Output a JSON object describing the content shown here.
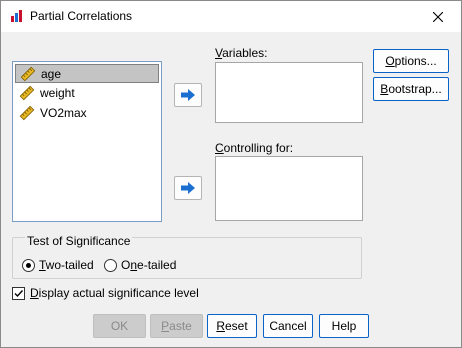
{
  "window": {
    "title": "Partial Correlations"
  },
  "variables_list": {
    "items": [
      {
        "label": "age",
        "selected": true
      },
      {
        "label": "weight",
        "selected": false
      },
      {
        "label": "VO2max",
        "selected": false
      }
    ]
  },
  "variables_field": {
    "label": "Variables:",
    "mnemonic": "V",
    "rest": "ariables:"
  },
  "controlling_field": {
    "label": "Controlling for:",
    "mnemonic": "C",
    "rest": "ontrolling for:"
  },
  "side_buttons": {
    "options": {
      "label": "Options...",
      "mnemonic": "O",
      "rest": "ptions..."
    },
    "bootstrap": {
      "label": "Bootstrap...",
      "mnemonic": "B",
      "rest": "ootstrap..."
    }
  },
  "significance": {
    "legend": "Test of Significance",
    "two_tailed": {
      "label": "Two-tailed",
      "mnemonic": "T",
      "rest": "wo-tailed",
      "checked": true
    },
    "one_tailed": {
      "label": "One-tailed",
      "mnemonic": "n",
      "prefix": "O",
      "rest": "e-tailed",
      "checked": false
    }
  },
  "display_level": {
    "label": "Display actual significance level",
    "mnemonic": "D",
    "rest": "isplay actual significance level",
    "checked": true
  },
  "buttons": {
    "ok": {
      "label": "OK",
      "enabled": false
    },
    "paste": {
      "label": "Paste",
      "mnemonic": "P",
      "rest": "aste",
      "enabled": false
    },
    "reset": {
      "label": "Reset",
      "mnemonic": "R",
      "rest": "eset",
      "enabled": true
    },
    "cancel": {
      "label": "Cancel",
      "enabled": true
    },
    "help": {
      "label": "Help",
      "enabled": true
    }
  },
  "colors": {
    "accent": "#0a64c8",
    "arrow_blue": "#1a6fd0",
    "ruler_yellow": "#e8b923"
  },
  "icons": {
    "arrow": "right-arrow-icon",
    "variable": "scale-ruler-icon",
    "close": "close-icon"
  }
}
